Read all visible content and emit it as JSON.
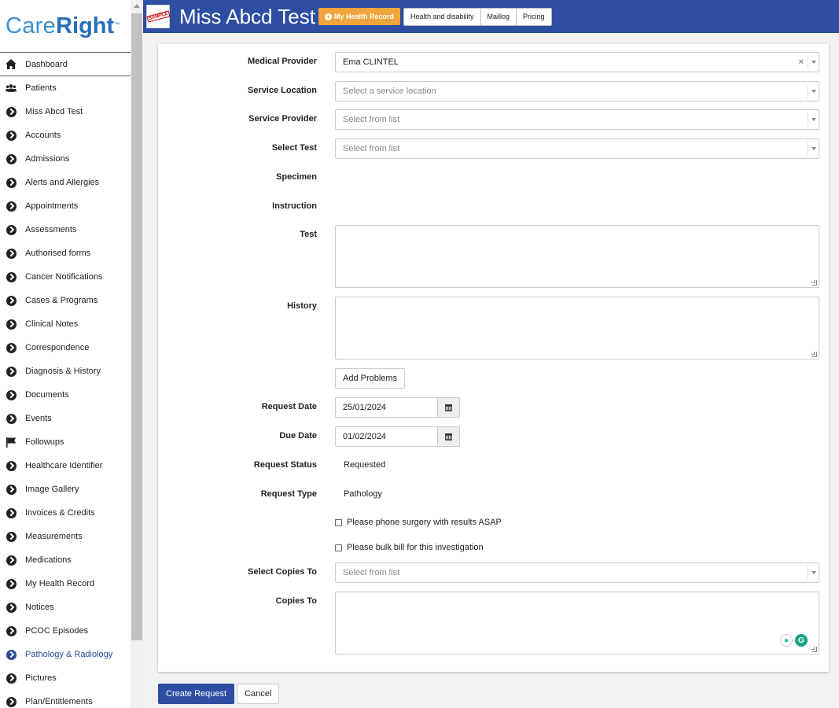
{
  "brand": {
    "care": "Care",
    "right": "Right",
    "tm": "™"
  },
  "sidebar": {
    "items": [
      {
        "label": "Dashboard",
        "icon": "home-icon"
      },
      {
        "label": "Patients",
        "icon": "users-icon"
      },
      {
        "label": "Miss Abcd Test",
        "icon": "chevron-circle-icon"
      },
      {
        "label": "Accounts",
        "icon": "chevron-circle-icon"
      },
      {
        "label": "Admissions",
        "icon": "chevron-circle-icon"
      },
      {
        "label": "Alerts and Allergies",
        "icon": "chevron-circle-icon"
      },
      {
        "label": "Appointments",
        "icon": "chevron-circle-icon"
      },
      {
        "label": "Assessments",
        "icon": "chevron-circle-icon"
      },
      {
        "label": "Authorised forms",
        "icon": "chevron-circle-icon"
      },
      {
        "label": "Cancer Notifications",
        "icon": "chevron-circle-icon"
      },
      {
        "label": "Cases & Programs",
        "icon": "chevron-circle-icon"
      },
      {
        "label": "Clinical Notes",
        "icon": "chevron-circle-icon"
      },
      {
        "label": "Correspondence",
        "icon": "chevron-circle-icon"
      },
      {
        "label": "Diagnosis & History",
        "icon": "chevron-circle-icon"
      },
      {
        "label": "Documents",
        "icon": "chevron-circle-icon"
      },
      {
        "label": "Events",
        "icon": "chevron-circle-icon"
      },
      {
        "label": "Followups",
        "icon": "flag-icon"
      },
      {
        "label": "Healthcare Identifier",
        "icon": "chevron-circle-icon"
      },
      {
        "label": "Image Gallery",
        "icon": "chevron-circle-icon"
      },
      {
        "label": "Invoices & Credits",
        "icon": "chevron-circle-icon"
      },
      {
        "label": "Measurements",
        "icon": "chevron-circle-icon"
      },
      {
        "label": "Medications",
        "icon": "chevron-circle-icon"
      },
      {
        "label": "My Health Record",
        "icon": "chevron-circle-icon"
      },
      {
        "label": "Notices",
        "icon": "chevron-circle-icon"
      },
      {
        "label": "PCOC Episodes",
        "icon": "chevron-circle-icon"
      },
      {
        "label": "Pathology & Radiology",
        "icon": "chevron-circle-icon",
        "active": true
      },
      {
        "label": "Pictures",
        "icon": "chevron-circle-icon"
      },
      {
        "label": "Plan/Entitlements",
        "icon": "chevron-circle-icon"
      }
    ]
  },
  "header": {
    "avatar_stamp": "SAMPLE",
    "patient_name": "Miss Abcd Test",
    "mhr_button": "My Health Record",
    "tabs": [
      "Health and disability",
      "Maillog",
      "Pricing"
    ]
  },
  "form": {
    "medical_provider": {
      "label": "Medical Provider",
      "value": "Ema CLINTEL",
      "clear": "×"
    },
    "service_location": {
      "label": "Service Location",
      "placeholder": "Select a service location"
    },
    "service_provider": {
      "label": "Service Provider",
      "placeholder": "Select from list"
    },
    "select_test": {
      "label": "Select Test",
      "placeholder": "Select from list"
    },
    "specimen": {
      "label": "Specimen"
    },
    "instruction": {
      "label": "Instruction"
    },
    "test": {
      "label": "Test"
    },
    "history": {
      "label": "History"
    },
    "add_problems": "Add Problems",
    "request_date": {
      "label": "Request Date",
      "value": "25/01/2024"
    },
    "due_date": {
      "label": "Due Date",
      "value": "01/02/2024"
    },
    "request_status": {
      "label": "Request Status",
      "value": "Requested"
    },
    "request_type": {
      "label": "Request Type",
      "value": "Pathology"
    },
    "phone_surgery": "Please phone surgery with results ASAP",
    "bulk_bill": "Please bulk bill for this investigation",
    "select_copies_to": {
      "label": "Select Copies To",
      "placeholder": "Select from list"
    },
    "copies_to": {
      "label": "Copies To"
    }
  },
  "actions": {
    "create": "Create Request",
    "cancel": "Cancel"
  },
  "colors": {
    "header": "#2d4ea3",
    "accent_orange": "#f0a53c",
    "active_nav": "#2b4a9e",
    "grammarly": "#15a385"
  }
}
